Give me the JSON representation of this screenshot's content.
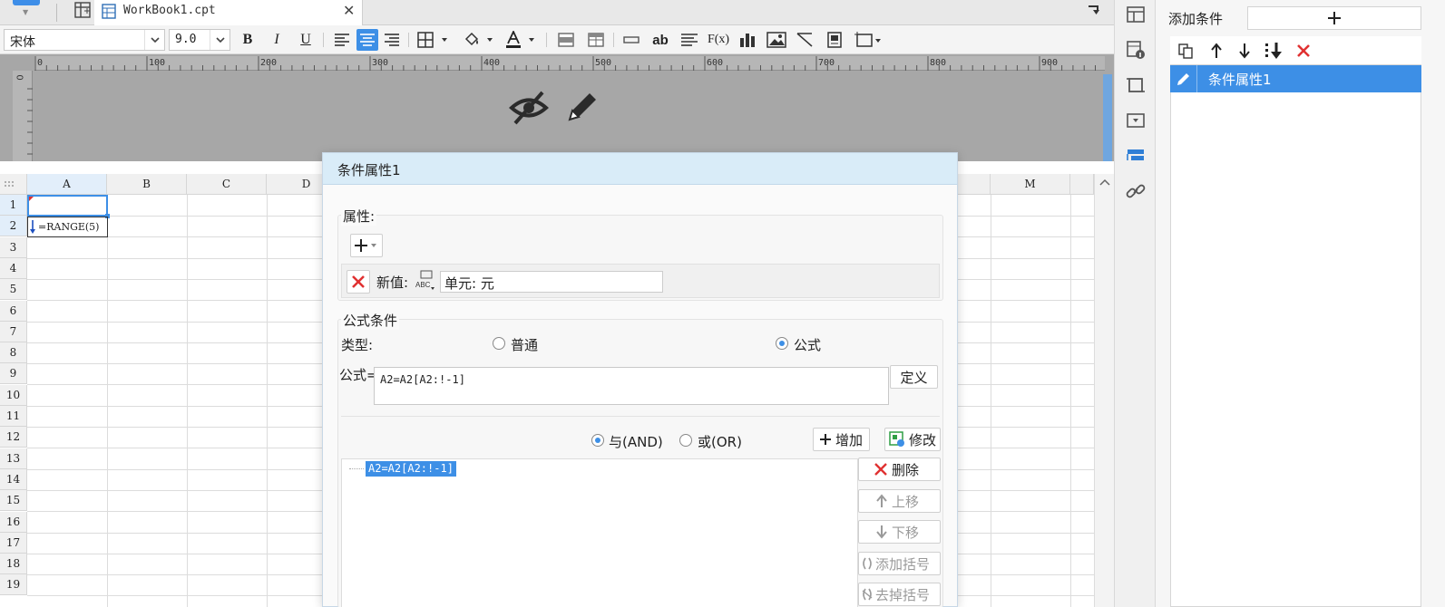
{
  "tabs": {
    "document_title": "WorkBook1.cpt"
  },
  "toolbar": {
    "font_name": "宋体",
    "font_size": "9.0",
    "bold": "B",
    "italic": "I",
    "underline": "U",
    "text_tool": "ab",
    "formula_tool": "F(x)"
  },
  "ruler": {
    "h_ticks": [
      "0",
      "100",
      "200",
      "300",
      "400",
      "500",
      "600",
      "700",
      "800",
      "900"
    ],
    "v_zero": "0"
  },
  "sheet": {
    "columns": [
      "A",
      "B",
      "C",
      "D",
      "M"
    ],
    "rows": [
      "1",
      "2",
      "3",
      "4",
      "5",
      "6",
      "7",
      "8",
      "9",
      "10",
      "11",
      "12",
      "13",
      "14",
      "15",
      "16",
      "17",
      "18",
      "19"
    ],
    "cell_a2": "=RANGE(5)"
  },
  "condition_panel": {
    "header_label": "添加条件",
    "add_icon": "plus-icon",
    "items": [
      {
        "label": "条件属性1"
      }
    ]
  },
  "dialog": {
    "title": "条件属性1",
    "attributes": {
      "legend": "属性:",
      "new_value_label": "新值:",
      "new_value": "单元: 元"
    },
    "formula_condition": {
      "legend": "公式条件",
      "type_label": "类型:",
      "type_options": [
        "普通",
        "公式"
      ],
      "type_selected": "公式",
      "formula_label": "公式=",
      "formula_value": "A2=A2[A2:!-1]",
      "define_button": "定义",
      "logic_options": [
        "与(AND)",
        "或(OR)"
      ],
      "logic_selected": "与(AND)",
      "add_button": "增加",
      "modify_button": "修改",
      "tree_item": "A2=A2[A2:!-1]",
      "delete_button": "删除",
      "move_up_button": "上移",
      "move_down_button": "下移",
      "add_bracket_button": "添加括号",
      "remove_bracket_button": "去掉括号"
    }
  },
  "colors": {
    "accent": "#3d8fe6",
    "danger": "#e03131",
    "dialog_title_bg": "#d9ecf8",
    "canvas_gray": "#a7a7a7"
  }
}
